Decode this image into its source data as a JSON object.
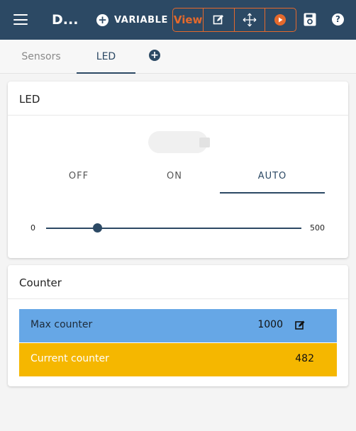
{
  "topbar": {
    "title": "D...",
    "variable_label": "VARIABLE",
    "view_label": "View",
    "colors": {
      "bar": "#2c4964",
      "accent": "#e4692c"
    }
  },
  "tabs": [
    {
      "label": "Sensors",
      "active": false
    },
    {
      "label": "LED",
      "active": true
    }
  ],
  "led_card": {
    "title": "LED",
    "modes": [
      "OFF",
      "ON",
      "AUTO"
    ],
    "selected_mode": "AUTO",
    "slider": {
      "min_label": "0",
      "max_label": "500",
      "min": 0,
      "max": 500,
      "value": 100
    }
  },
  "counter_card": {
    "title": "Counter",
    "max_counter": {
      "label": "Max counter",
      "value": "1000",
      "color": "#66a7e6"
    },
    "current_counter": {
      "label": "Current counter",
      "value": "482",
      "color": "#f5b700"
    }
  }
}
